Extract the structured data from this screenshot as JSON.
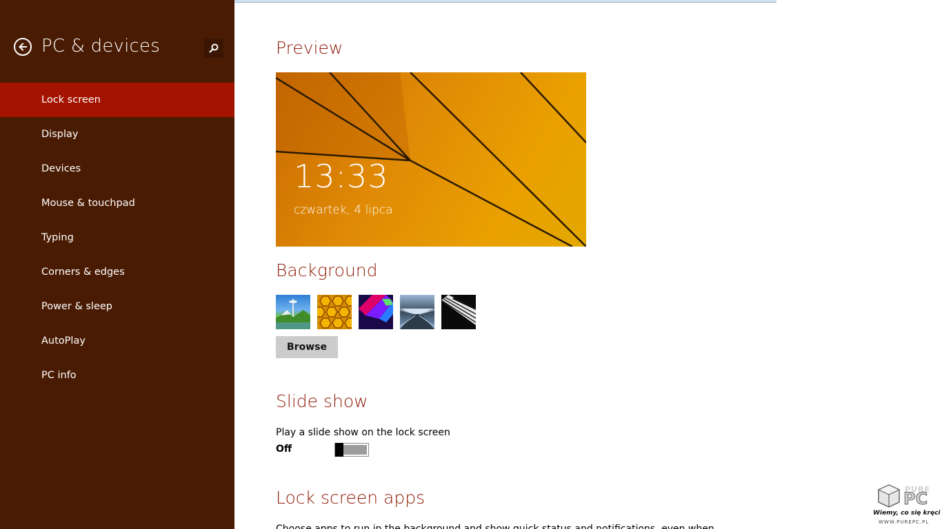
{
  "sidebar": {
    "title": "PC & devices",
    "items": [
      {
        "label": "Lock screen",
        "active": true
      },
      {
        "label": "Display",
        "active": false
      },
      {
        "label": "Devices",
        "active": false
      },
      {
        "label": "Mouse & touchpad",
        "active": false
      },
      {
        "label": "Typing",
        "active": false
      },
      {
        "label": "Corners & edges",
        "active": false
      },
      {
        "label": "Power & sleep",
        "active": false
      },
      {
        "label": "AutoPlay",
        "active": false
      },
      {
        "label": "PC info",
        "active": false
      }
    ]
  },
  "preview": {
    "title": "Preview",
    "time": "13:33",
    "date": "czwartek, 4 lipca"
  },
  "background": {
    "title": "Background",
    "browse_label": "Browse"
  },
  "slideshow": {
    "title": "Slide show",
    "setting_label": "Play a slide show on the lock screen",
    "state": "Off"
  },
  "lock_apps": {
    "title": "Lock screen apps",
    "description": "Choose apps to run in the background and show quick status and notifications, even when"
  },
  "watermark": {
    "brand_top": "PURE",
    "brand_main": "PC",
    "slogan": "Wiemy, co się kręci !",
    "url": "WWW.PUREPC.PL"
  },
  "colors": {
    "sidebar_bg": "#4a1b03",
    "sidebar_active": "#a41300",
    "accent_heading": "#8f1a06"
  }
}
